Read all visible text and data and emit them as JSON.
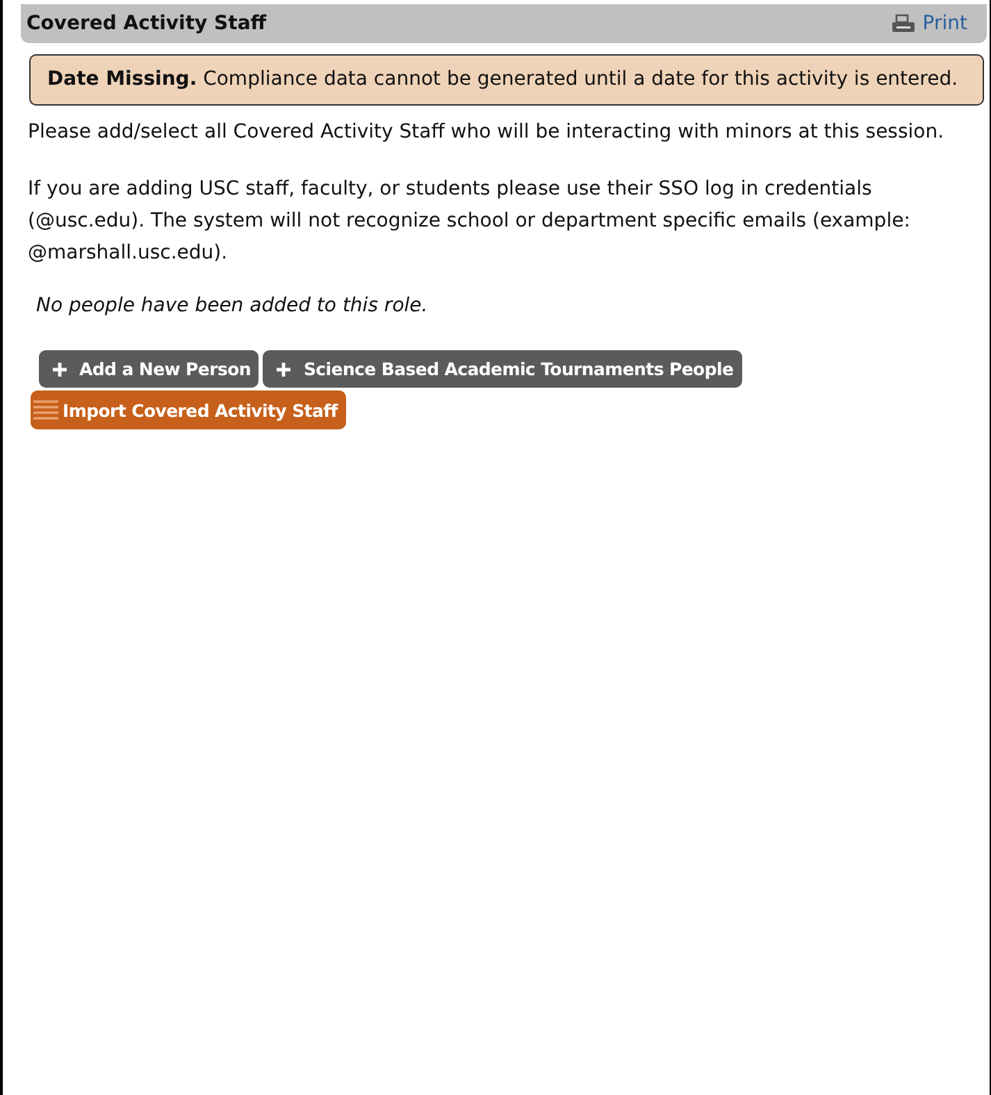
{
  "panel": {
    "title": "Covered Activity Staff",
    "print_link": "Print"
  },
  "alert": {
    "heading": "Date Missing.",
    "message": "Compliance data cannot be generated until a date for this activity is entered."
  },
  "paragraphs": [
    "Please add/select all Covered Activity Staff who will be interacting with minors at this session.",
    "If you are adding USC staff, faculty, or students please use their SSO log in credentials (@usc.edu). The system will not recognize school or department specific emails (example: @marshall.usc.edu)."
  ],
  "empty_note": "No people have been added to this role.",
  "button_rows": [
    [
      {
        "label": "Add a New Person",
        "kind": "add"
      },
      {
        "label": "Science Based Academic Tournaments People",
        "kind": "add"
      }
    ],
    [
      {
        "label": "Import Covered Activity Staff",
        "kind": "import"
      }
    ]
  ]
}
